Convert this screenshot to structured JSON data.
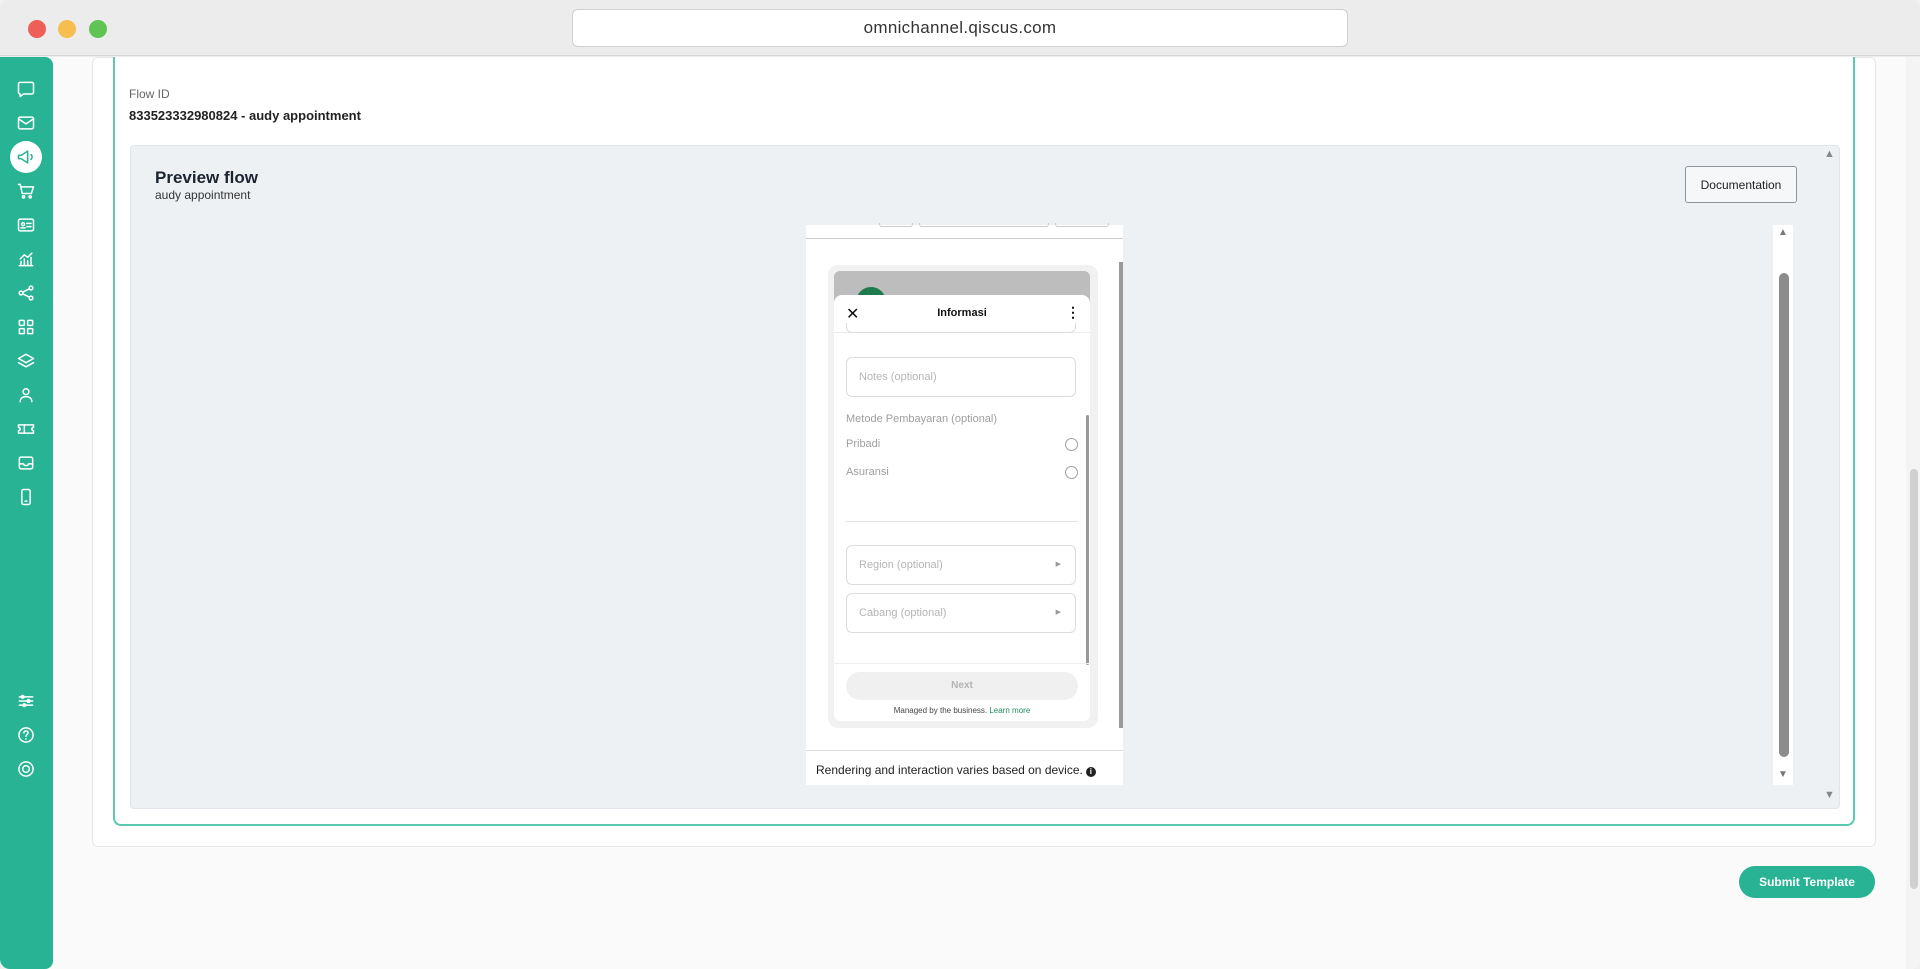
{
  "browser": {
    "url": "omnichannel.qiscus.com"
  },
  "sidebar": {
    "items": [
      {
        "icon": "chat-bubble-icon",
        "active": false
      },
      {
        "icon": "mail-icon",
        "active": false
      },
      {
        "icon": "megaphone-icon",
        "active": true
      },
      {
        "icon": "cart-icon",
        "active": false
      },
      {
        "icon": "contact-card-icon",
        "active": false
      },
      {
        "icon": "analytics-icon",
        "active": false
      },
      {
        "icon": "share-nodes-icon",
        "active": false
      },
      {
        "icon": "apps-grid-icon",
        "active": false
      },
      {
        "icon": "layers-icon",
        "active": false
      },
      {
        "icon": "user-agent-icon",
        "active": false
      },
      {
        "icon": "ticket-icon",
        "active": false
      },
      {
        "icon": "inbox-icon",
        "active": false
      },
      {
        "icon": "mobile-icon",
        "active": false
      }
    ],
    "bottom_items": [
      {
        "icon": "settings-sliders-icon"
      },
      {
        "icon": "help-icon"
      },
      {
        "icon": "power-icon"
      }
    ],
    "accent": "#27b394"
  },
  "flow": {
    "label": "Flow ID",
    "value": "833523332980824 - audy appointment"
  },
  "preview": {
    "title": "Preview flow",
    "subtitle": "audy appointment",
    "documentation_label": "Documentation",
    "footer_note": "Rendering and interaction varies based on device."
  },
  "phone": {
    "sheet_title": "Informasi",
    "close_glyph": "✕",
    "menu_glyph": "⋮",
    "notes_placeholder": "Notes (optional)",
    "payment_label": "Metode Pembayaran (optional)",
    "payment_options": [
      "Pribadi",
      "Asuransi"
    ],
    "region_placeholder": "Region (optional)",
    "branch_placeholder": "Cabang (optional)",
    "next_label": "Next",
    "managed_text": "Managed by the business.",
    "learn_more": "Learn more"
  },
  "actions": {
    "submit_label": "Submit Template"
  }
}
